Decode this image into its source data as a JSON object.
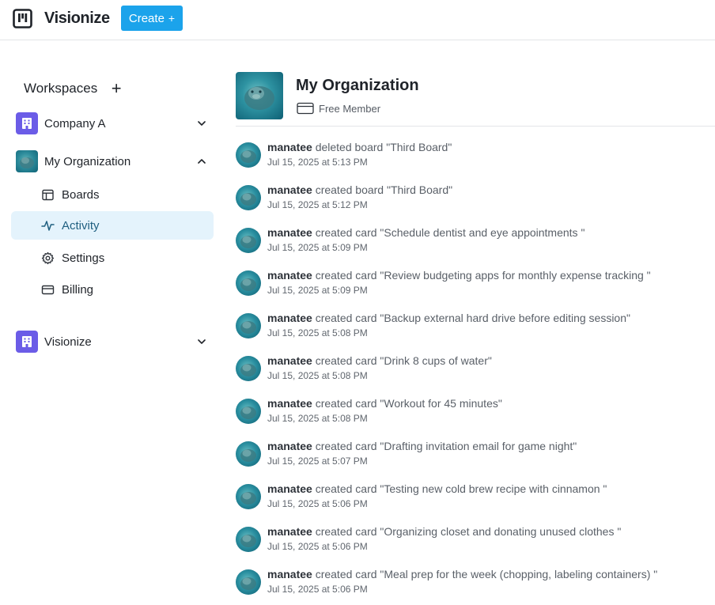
{
  "topbar": {
    "brand": "Visionize",
    "create_label": "Create",
    "create_icon": "+"
  },
  "sidebar": {
    "title": "Workspaces",
    "add_icon": "+",
    "workspaces": [
      {
        "label": "Company A",
        "avatar": "building-icon",
        "expanded": false
      },
      {
        "label": "My Organization",
        "avatar": "manatee-photo",
        "expanded": true
      },
      {
        "label": "Visionize",
        "avatar": "building-icon",
        "expanded": false
      }
    ],
    "sub_items": [
      {
        "label": "Boards",
        "icon": "board-icon",
        "active": false
      },
      {
        "label": "Activity",
        "icon": "activity-icon",
        "active": true
      },
      {
        "label": "Settings",
        "icon": "gear-icon",
        "active": false
      },
      {
        "label": "Billing",
        "icon": "credit-card-icon",
        "active": false
      }
    ]
  },
  "main": {
    "org_name": "My Organization",
    "plan": "Free Member",
    "activities": [
      {
        "user": "manatee",
        "action": " deleted board \"Third Board\"",
        "time": "Jul 15, 2025 at 5:13 PM"
      },
      {
        "user": "manatee",
        "action": " created board \"Third Board\"",
        "time": "Jul 15, 2025 at 5:12 PM"
      },
      {
        "user": "manatee",
        "action": " created card \"Schedule dentist and eye appointments \"",
        "time": "Jul 15, 2025 at 5:09 PM"
      },
      {
        "user": "manatee",
        "action": " created card \"Review budgeting apps for monthly expense tracking \"",
        "time": "Jul 15, 2025 at 5:09 PM"
      },
      {
        "user": "manatee",
        "action": " created card \"Backup external hard drive before editing session\"",
        "time": "Jul 15, 2025 at 5:08 PM"
      },
      {
        "user": "manatee",
        "action": " created card \"Drink 8 cups of water\"",
        "time": "Jul 15, 2025 at 5:08 PM"
      },
      {
        "user": "manatee",
        "action": " created card \"Workout for 45 minutes\"",
        "time": "Jul 15, 2025 at 5:08 PM"
      },
      {
        "user": "manatee",
        "action": " created card \"Drafting invitation email for game night\"",
        "time": "Jul 15, 2025 at 5:07 PM"
      },
      {
        "user": "manatee",
        "action": " created card \"Testing new cold brew recipe with cinnamon \"",
        "time": "Jul 15, 2025 at 5:06 PM"
      },
      {
        "user": "manatee",
        "action": " created card \"Organizing closet and donating unused clothes \"",
        "time": "Jul 15, 2025 at 5:06 PM"
      },
      {
        "user": "manatee",
        "action": " created card \"Meal prep for the week (chopping, labeling containers) \"",
        "time": "Jul 15, 2025 at 5:06 PM"
      }
    ]
  },
  "colors": {
    "accent": "#1ba3eb",
    "workspace_avatar": "#6b5ce7",
    "active_bg": "#e4f3fc"
  }
}
